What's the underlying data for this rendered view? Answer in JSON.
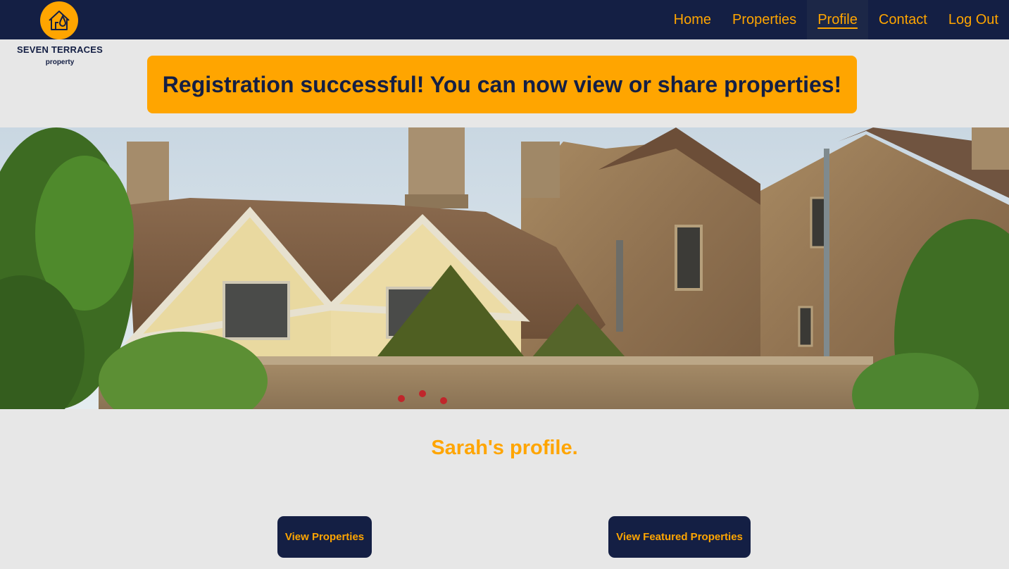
{
  "brand": {
    "name": "SEVEN TERRACES",
    "tagline": "property",
    "icon": "house-drop-icon",
    "color_primary": "#141f44",
    "color_accent": "#ffa500"
  },
  "nav": {
    "items": [
      {
        "label": "Home",
        "active": false
      },
      {
        "label": "Properties",
        "active": false
      },
      {
        "label": "Profile",
        "active": true
      },
      {
        "label": "Contact",
        "active": false
      },
      {
        "label": "Log Out",
        "active": false
      }
    ]
  },
  "alert": {
    "message": "Registration successful! You can now view or share properties!"
  },
  "hero": {
    "image": "stone-manor-house-photo"
  },
  "profile": {
    "title": "Sarah's profile."
  },
  "actions": {
    "view_properties": "View Properties",
    "view_featured": "View Featured Properties"
  }
}
